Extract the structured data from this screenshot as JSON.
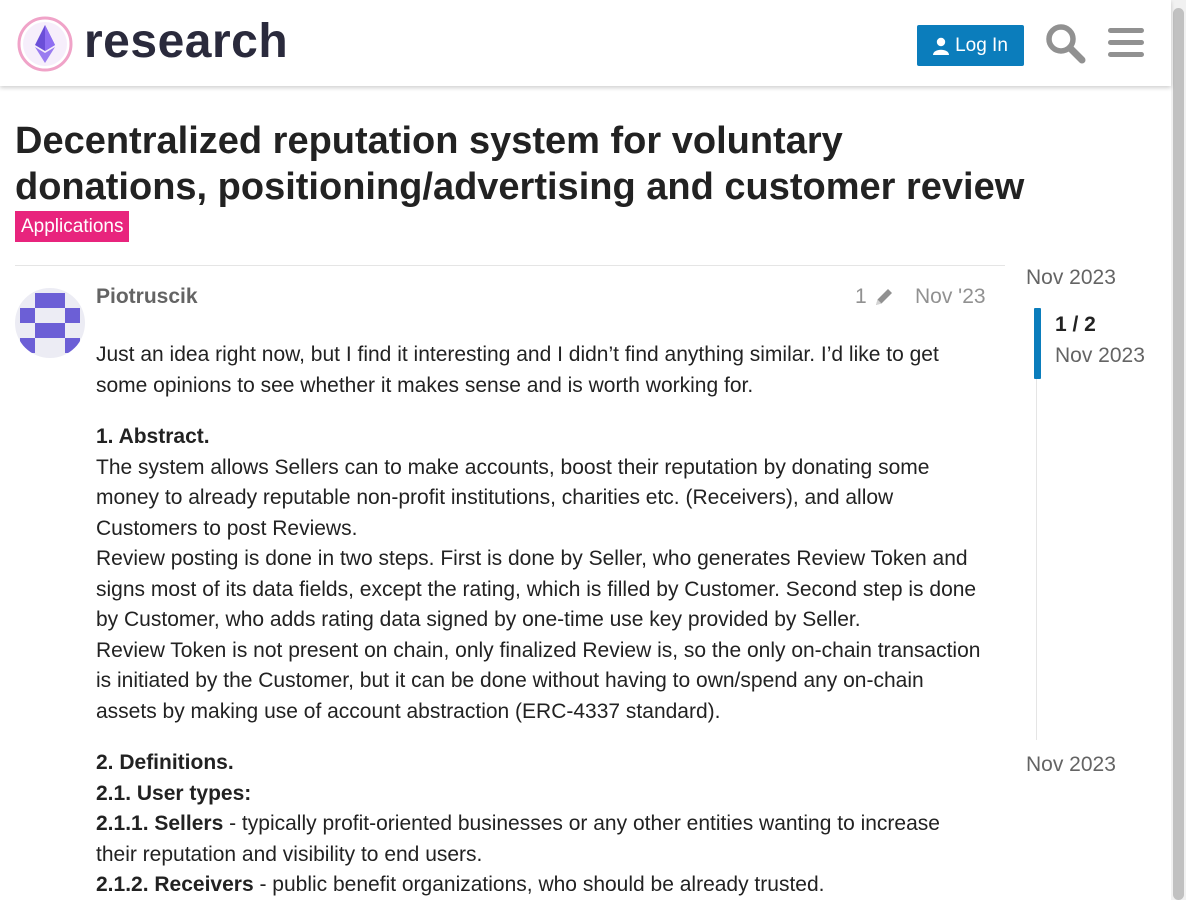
{
  "header": {
    "site_name": "research",
    "login_label": "Log In",
    "icons": [
      "site-logo",
      "user-icon",
      "search-icon",
      "hamburger-menu-icon"
    ]
  },
  "topic": {
    "title": "Decentralized reputation system for voluntary donations, positioning/advertising and customer review",
    "category": "Applications",
    "category_color": "#e8247d"
  },
  "post": {
    "author": "Piotruscik",
    "edit_count": "1",
    "date": "Nov '23",
    "intro": "Just an idea right now, but I find it interesting and I didn’t find anything similar. I’d like to get some opinions to see whether it makes sense and is worth working for.",
    "abstract_heading": "1. Abstract.",
    "abstract_p1": "The system allows Sellers can to make accounts, boost their reputation by donating some money to already reputable non-profit institutions, charities etc. (Receivers), and allow Customers to post Reviews.",
    "abstract_p2": "Review posting is done in two steps. First is done by Seller, who generates Review Token and signs most of its data fields, except the rating, which is filled by Customer. Second step is done by Customer, who adds rating data signed by one-time use key provided by Seller.",
    "abstract_p3": "Review Token is not present on chain, only finalized Review is, so the only on-chain transaction is initiated by the Customer, but it can be done without having to own/spend any on-chain assets by making use of account abstraction (ERC-4337 standard).",
    "definitions_heading": "2. Definitions.",
    "user_types_heading": "2.1. User types:",
    "sellers_term": "2.1.1. Sellers",
    "sellers_desc": " - typically profit-oriented businesses or any other entities wanting to increase their reputation and visibility to end users.",
    "receivers_term": "2.1.2. Receivers",
    "receivers_desc": " - public benefit organizations, who should be already trusted."
  },
  "timeline": {
    "start_date": "Nov 2023",
    "position": "1 / 2",
    "current_date": "Nov 2023",
    "end_date": "Nov 2023"
  },
  "colors": {
    "primary": "#0b7dbc",
    "category": "#e8247d",
    "avatar": "#6c5fd6",
    "muted_text": "#919191"
  }
}
